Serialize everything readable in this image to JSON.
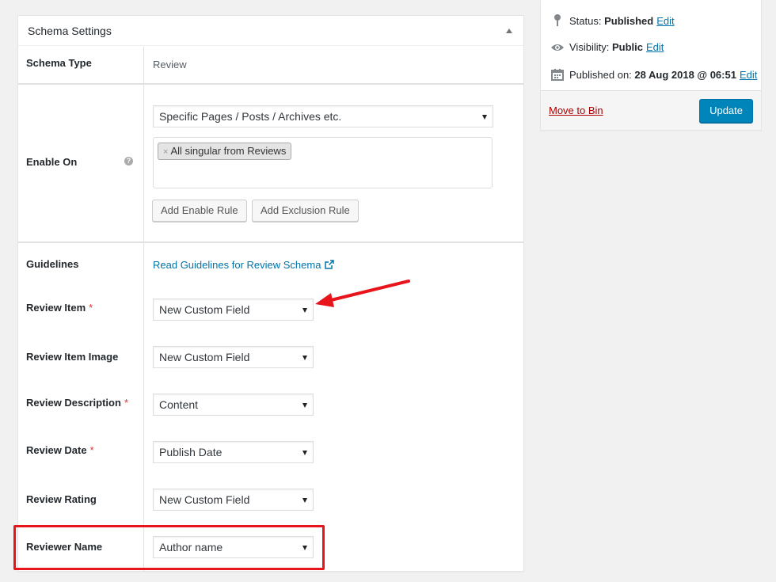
{
  "metabox": {
    "title": "Schema Settings"
  },
  "schema_type": {
    "label": "Schema Type",
    "value": "Review"
  },
  "enable_on": {
    "label": "Enable On",
    "help": "?",
    "select_value": "Specific Pages / Posts / Archives etc.",
    "tags": [
      "All singular from Reviews"
    ],
    "tag_remove": "×",
    "add_enable_rule": "Add Enable Rule",
    "add_exclusion_rule": "Add Exclusion Rule"
  },
  "guidelines": {
    "label": "Guidelines",
    "link_text": "Read Guidelines for Review Schema"
  },
  "fields": [
    {
      "label": "Review Item",
      "required": true,
      "value": "New Custom Field"
    },
    {
      "label": "Review Item Image",
      "required": false,
      "value": "New Custom Field"
    },
    {
      "label": "Review Description",
      "required": true,
      "value": "Content"
    },
    {
      "label": "Review Date",
      "required": true,
      "value": "Publish Date"
    },
    {
      "label": "Review Rating",
      "required": false,
      "value": "New Custom Field"
    },
    {
      "label": "Reviewer Name",
      "required": false,
      "value": "Author name"
    }
  ],
  "required_marker": "*",
  "publish": {
    "status_label": "Status:",
    "status_value": "Published",
    "visibility_label": "Visibility:",
    "visibility_value": "Public",
    "published_on_label": "Published on:",
    "published_on_value": "28 Aug 2018 @ 06:51",
    "edit": "Edit",
    "move_to_bin": "Move to Bin",
    "update": "Update"
  },
  "colors": {
    "accent": "#0073aa",
    "primary_button": "#0085ba",
    "annotation": "#e8141b",
    "required": "#dc3232"
  },
  "icons": {
    "toggle": "triangle-up-icon",
    "help": "question-circle-icon",
    "external": "external-link-icon",
    "status": "pin-icon",
    "visibility": "eye-icon",
    "date": "calendar-icon"
  }
}
